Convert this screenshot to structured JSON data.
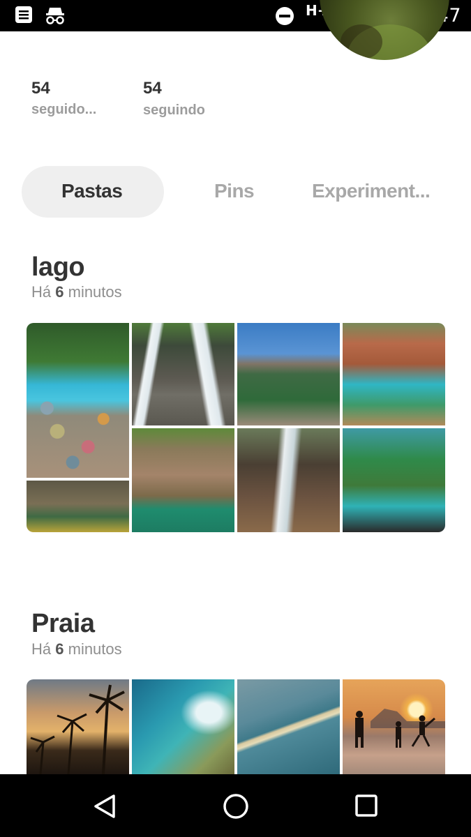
{
  "status_bar": {
    "time": "20:47",
    "network": "H+",
    "icons": [
      "notification-icon",
      "incognito-icon",
      "dnd-icon",
      "signal-icon",
      "signal-icon",
      "battery-charging-icon"
    ]
  },
  "profile": {
    "followers": {
      "count": "54",
      "label": "seguido..."
    },
    "following": {
      "count": "54",
      "label": "seguindo"
    }
  },
  "tabs": [
    {
      "label": "Pastas",
      "active": true
    },
    {
      "label": "Pins",
      "active": false
    },
    {
      "label": "Experiment...",
      "active": false
    }
  ],
  "boards": [
    {
      "title": "lago",
      "updated_prefix": "Há ",
      "updated_num": "6",
      "updated_suffix": " minutos"
    },
    {
      "title": "Praia",
      "updated_prefix": "Há ",
      "updated_num": "6",
      "updated_suffix": " minutos"
    }
  ],
  "colors": {
    "active_tab_bg": "#efefef",
    "text_dark": "#333333",
    "text_muted": "#9c9c9c"
  },
  "nav_bar": [
    "back-icon",
    "home-icon",
    "recents-icon"
  ]
}
